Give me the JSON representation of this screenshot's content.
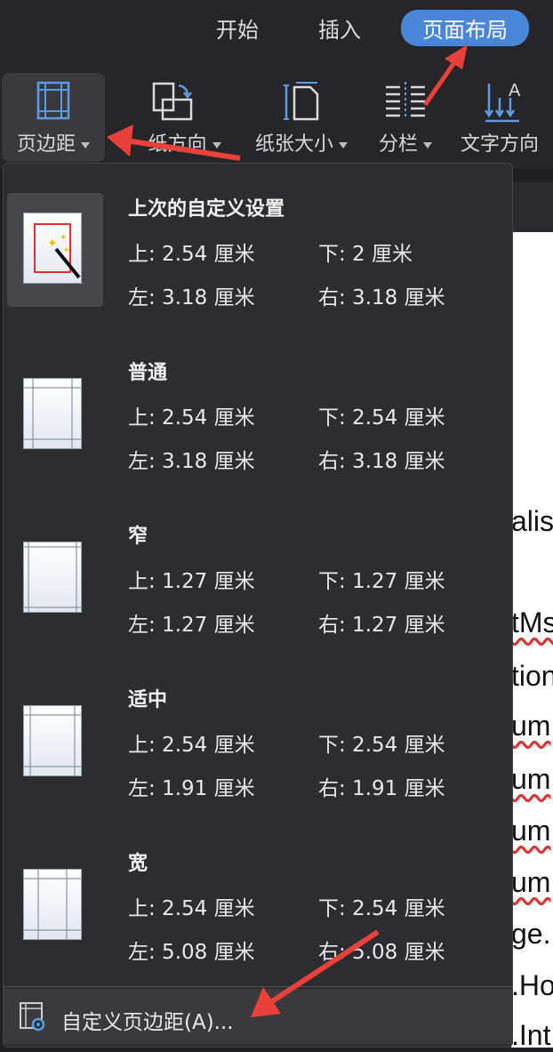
{
  "tabs": [
    {
      "label": "开始"
    },
    {
      "label": "插入"
    },
    {
      "label": "页面布局",
      "active": true
    }
  ],
  "ribbon": {
    "margins": "页边距",
    "orientation": "纸方向",
    "paper_size": "纸张大小",
    "columns": "分栏",
    "text_direction": "文字方向"
  },
  "menu": {
    "items": [
      {
        "title": "上次的自定义设置",
        "top": "上: 2.54 厘米",
        "bottom": "下: 2 厘米",
        "left": "左: 3.18 厘米",
        "right": "右: 3.18 厘米"
      },
      {
        "title": "普通",
        "top": "上: 2.54 厘米",
        "bottom": "下: 2.54 厘米",
        "left": "左: 3.18 厘米",
        "right": "右: 3.18 厘米"
      },
      {
        "title": "窄",
        "top": "上: 1.27 厘米",
        "bottom": "下: 1.27 厘米",
        "left": "左: 1.27 厘米",
        "right": "右: 1.27 厘米"
      },
      {
        "title": "适中",
        "top": "上: 2.54 厘米",
        "bottom": "下: 2.54 厘米",
        "left": "左: 1.91 厘米",
        "right": "右: 1.91 厘米"
      },
      {
        "title": "宽",
        "top": "上: 2.54 厘米",
        "bottom": "下: 2.54 厘米",
        "left": "左: 5.08 厘米",
        "right": "右: 5.08 厘米"
      }
    ],
    "custom": "自定义页边距(A)..."
  },
  "doc_fragments": [
    "alis",
    "tMs",
    "tion",
    "um",
    "um",
    "um",
    "um",
    "ge.",
    ".Ho",
    ".Int"
  ],
  "colors": {
    "accent": "#4a86d8",
    "annotation_arrow": "#e8403a"
  }
}
